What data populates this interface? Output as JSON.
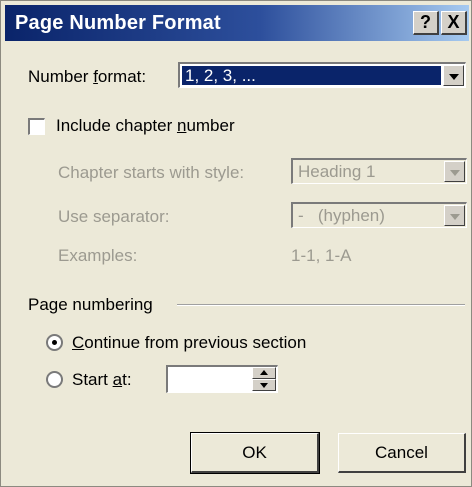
{
  "dialog": {
    "title": "Page Number Format",
    "help_label": "?",
    "close_label": "X"
  },
  "number_format": {
    "label_pre": "Number ",
    "label_accel": "f",
    "label_post": "ormat:",
    "value": "1, 2, 3, ..."
  },
  "chapter": {
    "checkbox_label_pre": "Include chapter ",
    "checkbox_label_accel": "n",
    "checkbox_label_post": "umber",
    "checked": false,
    "starts_with_label": "Chapter starts with style:",
    "starts_with_value": "Heading 1",
    "separator_label": "Use separator:",
    "separator_value": "-   (hyphen)",
    "examples_label": "Examples:",
    "examples_value": "1-1, 1-A"
  },
  "page_numbering": {
    "group_label": "Page numbering",
    "continue_label_pre": "",
    "continue_label_accel": "C",
    "continue_label_post": "ontinue from previous section",
    "continue_selected": true,
    "start_at_label_pre": "Start ",
    "start_at_label_accel": "a",
    "start_at_label_post": "t:",
    "start_at_value": ""
  },
  "buttons": {
    "ok": "OK",
    "cancel": "Cancel"
  }
}
